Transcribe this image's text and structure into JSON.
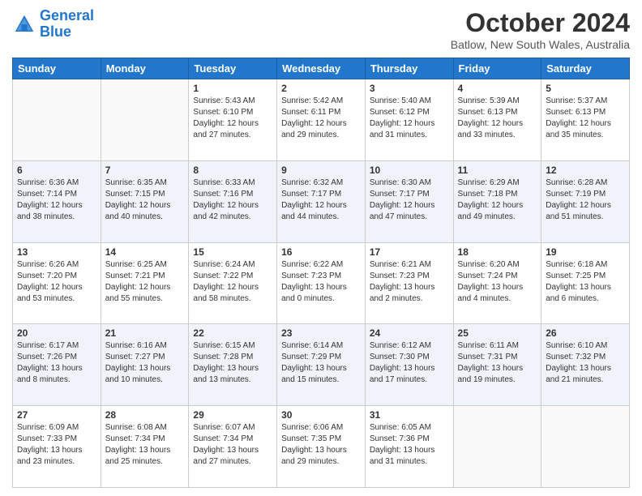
{
  "header": {
    "logo_line1": "General",
    "logo_line2": "Blue",
    "month_title": "October 2024",
    "location": "Batlow, New South Wales, Australia"
  },
  "weekdays": [
    "Sunday",
    "Monday",
    "Tuesday",
    "Wednesday",
    "Thursday",
    "Friday",
    "Saturday"
  ],
  "weeks": [
    [
      {
        "day": "",
        "info": ""
      },
      {
        "day": "",
        "info": ""
      },
      {
        "day": "1",
        "info": "Sunrise: 5:43 AM\nSunset: 6:10 PM\nDaylight: 12 hours\nand 27 minutes."
      },
      {
        "day": "2",
        "info": "Sunrise: 5:42 AM\nSunset: 6:11 PM\nDaylight: 12 hours\nand 29 minutes."
      },
      {
        "day": "3",
        "info": "Sunrise: 5:40 AM\nSunset: 6:12 PM\nDaylight: 12 hours\nand 31 minutes."
      },
      {
        "day": "4",
        "info": "Sunrise: 5:39 AM\nSunset: 6:13 PM\nDaylight: 12 hours\nand 33 minutes."
      },
      {
        "day": "5",
        "info": "Sunrise: 5:37 AM\nSunset: 6:13 PM\nDaylight: 12 hours\nand 35 minutes."
      }
    ],
    [
      {
        "day": "6",
        "info": "Sunrise: 6:36 AM\nSunset: 7:14 PM\nDaylight: 12 hours\nand 38 minutes."
      },
      {
        "day": "7",
        "info": "Sunrise: 6:35 AM\nSunset: 7:15 PM\nDaylight: 12 hours\nand 40 minutes."
      },
      {
        "day": "8",
        "info": "Sunrise: 6:33 AM\nSunset: 7:16 PM\nDaylight: 12 hours\nand 42 minutes."
      },
      {
        "day": "9",
        "info": "Sunrise: 6:32 AM\nSunset: 7:17 PM\nDaylight: 12 hours\nand 44 minutes."
      },
      {
        "day": "10",
        "info": "Sunrise: 6:30 AM\nSunset: 7:17 PM\nDaylight: 12 hours\nand 47 minutes."
      },
      {
        "day": "11",
        "info": "Sunrise: 6:29 AM\nSunset: 7:18 PM\nDaylight: 12 hours\nand 49 minutes."
      },
      {
        "day": "12",
        "info": "Sunrise: 6:28 AM\nSunset: 7:19 PM\nDaylight: 12 hours\nand 51 minutes."
      }
    ],
    [
      {
        "day": "13",
        "info": "Sunrise: 6:26 AM\nSunset: 7:20 PM\nDaylight: 12 hours\nand 53 minutes."
      },
      {
        "day": "14",
        "info": "Sunrise: 6:25 AM\nSunset: 7:21 PM\nDaylight: 12 hours\nand 55 minutes."
      },
      {
        "day": "15",
        "info": "Sunrise: 6:24 AM\nSunset: 7:22 PM\nDaylight: 12 hours\nand 58 minutes."
      },
      {
        "day": "16",
        "info": "Sunrise: 6:22 AM\nSunset: 7:23 PM\nDaylight: 13 hours\nand 0 minutes."
      },
      {
        "day": "17",
        "info": "Sunrise: 6:21 AM\nSunset: 7:23 PM\nDaylight: 13 hours\nand 2 minutes."
      },
      {
        "day": "18",
        "info": "Sunrise: 6:20 AM\nSunset: 7:24 PM\nDaylight: 13 hours\nand 4 minutes."
      },
      {
        "day": "19",
        "info": "Sunrise: 6:18 AM\nSunset: 7:25 PM\nDaylight: 13 hours\nand 6 minutes."
      }
    ],
    [
      {
        "day": "20",
        "info": "Sunrise: 6:17 AM\nSunset: 7:26 PM\nDaylight: 13 hours\nand 8 minutes."
      },
      {
        "day": "21",
        "info": "Sunrise: 6:16 AM\nSunset: 7:27 PM\nDaylight: 13 hours\nand 10 minutes."
      },
      {
        "day": "22",
        "info": "Sunrise: 6:15 AM\nSunset: 7:28 PM\nDaylight: 13 hours\nand 13 minutes."
      },
      {
        "day": "23",
        "info": "Sunrise: 6:14 AM\nSunset: 7:29 PM\nDaylight: 13 hours\nand 15 minutes."
      },
      {
        "day": "24",
        "info": "Sunrise: 6:12 AM\nSunset: 7:30 PM\nDaylight: 13 hours\nand 17 minutes."
      },
      {
        "day": "25",
        "info": "Sunrise: 6:11 AM\nSunset: 7:31 PM\nDaylight: 13 hours\nand 19 minutes."
      },
      {
        "day": "26",
        "info": "Sunrise: 6:10 AM\nSunset: 7:32 PM\nDaylight: 13 hours\nand 21 minutes."
      }
    ],
    [
      {
        "day": "27",
        "info": "Sunrise: 6:09 AM\nSunset: 7:33 PM\nDaylight: 13 hours\nand 23 minutes."
      },
      {
        "day": "28",
        "info": "Sunrise: 6:08 AM\nSunset: 7:34 PM\nDaylight: 13 hours\nand 25 minutes."
      },
      {
        "day": "29",
        "info": "Sunrise: 6:07 AM\nSunset: 7:34 PM\nDaylight: 13 hours\nand 27 minutes."
      },
      {
        "day": "30",
        "info": "Sunrise: 6:06 AM\nSunset: 7:35 PM\nDaylight: 13 hours\nand 29 minutes."
      },
      {
        "day": "31",
        "info": "Sunrise: 6:05 AM\nSunset: 7:36 PM\nDaylight: 13 hours\nand 31 minutes."
      },
      {
        "day": "",
        "info": ""
      },
      {
        "day": "",
        "info": ""
      }
    ]
  ]
}
